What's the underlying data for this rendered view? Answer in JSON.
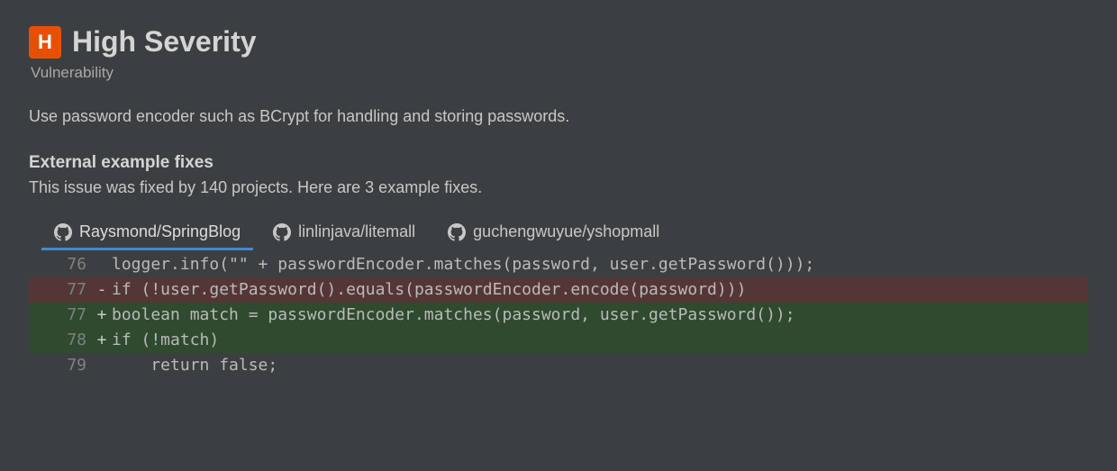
{
  "header": {
    "badge_letter": "H",
    "title": "High Severity",
    "subtitle": "Vulnerability"
  },
  "description": "Use password encoder such as BCrypt for handling and storing passwords.",
  "section": {
    "heading": "External example fixes",
    "sub": "This issue was fixed by 140 projects. Here are 3 example fixes."
  },
  "tabs": [
    {
      "label": "Raysmond/SpringBlog",
      "active": true
    },
    {
      "label": "linlinjava/litemall",
      "active": false
    },
    {
      "label": "guchengwuyue/yshopmall",
      "active": false
    }
  ],
  "diff": [
    {
      "no": "76",
      "sign": " ",
      "kind": "ctx",
      "code": "logger.info(\"\" + passwordEncoder.matches(password, user.getPassword()));"
    },
    {
      "no": "77",
      "sign": "-",
      "kind": "removed",
      "code": "if (!user.getPassword().equals(passwordEncoder.encode(password)))"
    },
    {
      "no": "77",
      "sign": "+",
      "kind": "added",
      "code": "boolean match = passwordEncoder.matches(password, user.getPassword());"
    },
    {
      "no": "78",
      "sign": "+",
      "kind": "added",
      "code": "if (!match)"
    },
    {
      "no": "79",
      "sign": " ",
      "kind": "ctx",
      "code": "    return false;"
    }
  ]
}
